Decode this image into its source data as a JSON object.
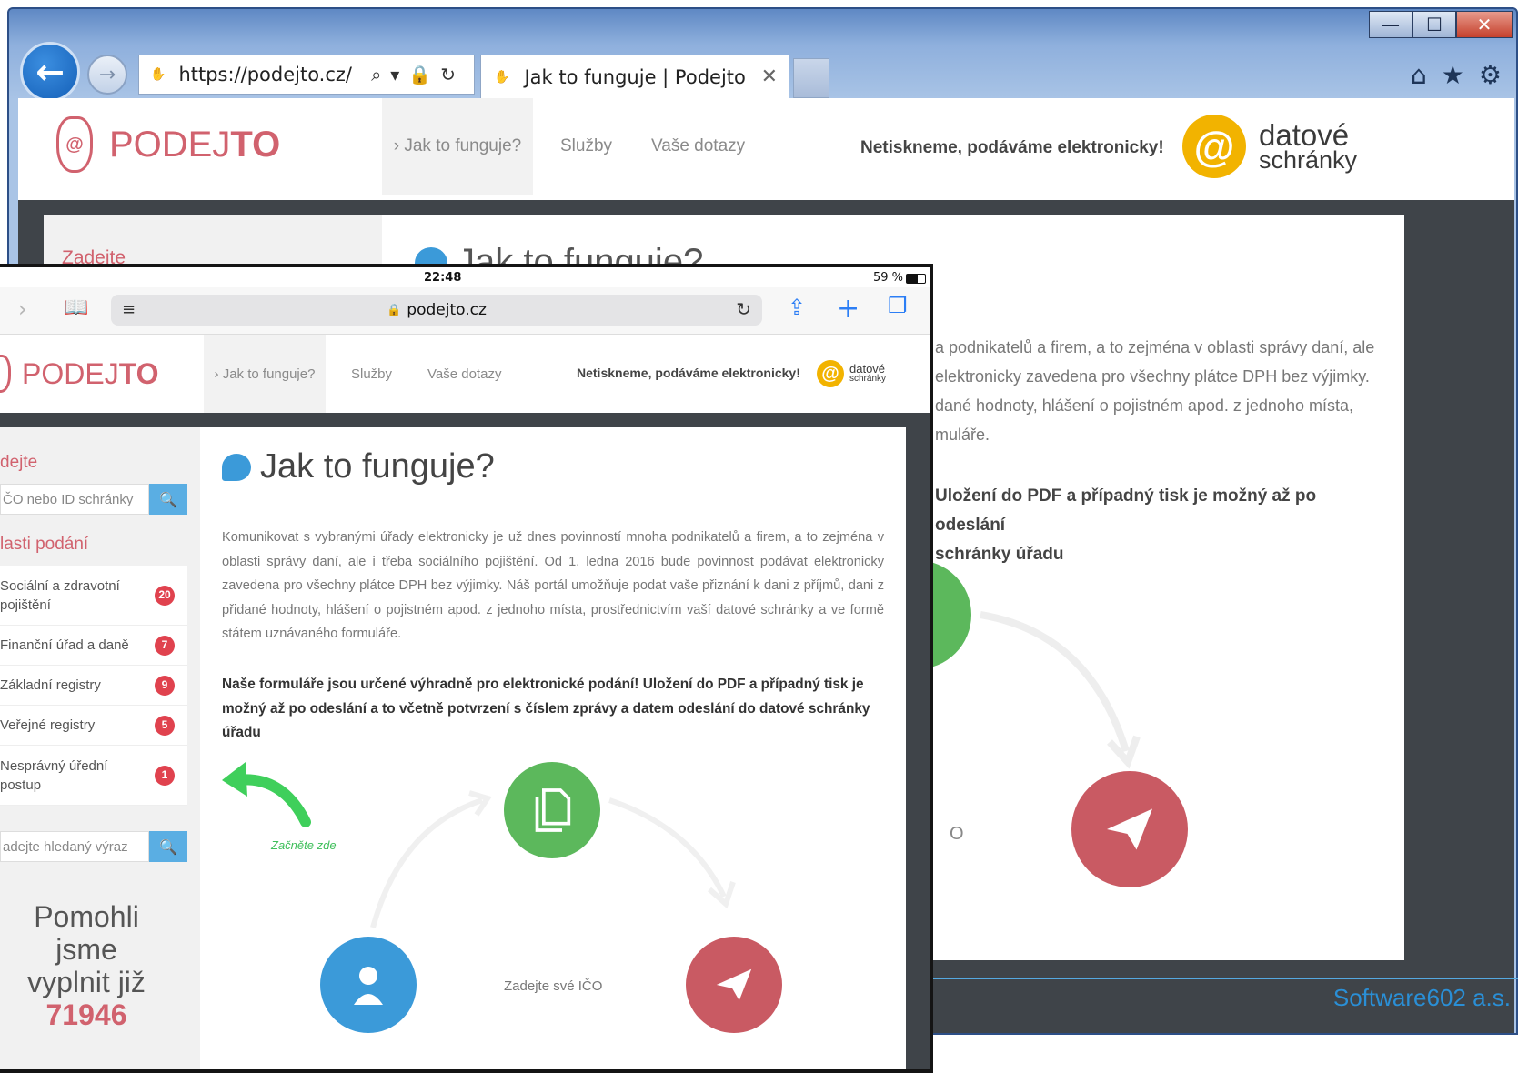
{
  "ie": {
    "url": "https://podejto.cz/",
    "tab_title": "Jak to funguje | Podejto",
    "tab_close": "✕",
    "win_min": "—",
    "win_max": "☐",
    "win_close": "✕",
    "back": "←",
    "forward": "→",
    "tools": "⌕▾🔒↻",
    "home": "⌂",
    "favorites": "★",
    "settings": "⚙"
  },
  "site": {
    "logo_text_a": "PODEJ",
    "logo_text_b": "TO",
    "nav": [
      {
        "label": "› Jak to funguje?"
      },
      {
        "label": "Služby"
      },
      {
        "label": "Vaše dotazy"
      }
    ],
    "slogan": "Netiskneme, podáváme elektronicky!",
    "ds_at": "@",
    "ds_line1": "datové",
    "ds_line2": "schránky"
  },
  "ie_page": {
    "side_heading": "Zadejte",
    "title": "Jak to funguje?",
    "para_lines": [
      "a podnikatelů a firem, a to zejména v oblasti správy daní, ale",
      "elektronicky zavedena pro všechny plátce DPH bez výjimky.",
      "dané hodnoty, hlášení o pojistném apod. z jednoho místa,",
      "muláře."
    ],
    "bold_lines": [
      "Uložení do PDF a případný tisk je možný až po odeslání",
      "schránky úřadu"
    ],
    "partial_label": "O"
  },
  "ipad": {
    "time": "22:48",
    "battery": "59 %",
    "url": "podejto.cz",
    "side": {
      "heading1": "dejte",
      "search1_placeholder": "ČO nebo ID schránky",
      "heading2": "lasti podání",
      "items": [
        {
          "label": "Sociální a zdravotní pojištění",
          "count": "20"
        },
        {
          "label": "Finanční úřad a daně",
          "count": "7"
        },
        {
          "label": "Základní registry",
          "count": "9"
        },
        {
          "label": "Veřejné registry",
          "count": "5"
        },
        {
          "label": "Nesprávný úřední postup",
          "count": "1"
        }
      ],
      "search2_placeholder": "adejte hledaný výraz",
      "counter_line1": "Pomohli jsme",
      "counter_line2": "vyplnit již",
      "counter_number": "71946"
    },
    "title": "Jak to funguje?",
    "paragraph": "Komunikovat s vybranými úřady elektronicky je už dnes povinností mnoha podnikatelů a firem, a to zejména v oblasti správy daní, ale i třeba sociálního pojištění. Od 1. ledna 2016 bude povinnost podávat elektronicky zavedena pro všechny plátce DPH bez výjimky. Náš portál umožňuje podat vaše přiznání k dani z příjmů, dani z přidané hodnoty, hlášení o pojistném apod. z jednoho místa, prostřednictvím vaší datové schránky a ve formě státem uznávaného formuláře.",
    "bold": "Naše formuláře jsou určené výhradně pro elektronické podání! Uložení do PDF a případný tisk je možný až po odeslání a to včetně potvrzení s číslem zprávy a datem odeslání do datové schránky úřadu",
    "start_label": "Začněte zde",
    "step_label": "Zadejte své IČO"
  },
  "footer": "Software602 a.s.",
  "colors": {
    "brand_red": "#d1626e",
    "ds_yellow": "#f2b300",
    "blue": "#3b9ad9",
    "green": "#5cb85c",
    "badge": "#e0424e"
  }
}
